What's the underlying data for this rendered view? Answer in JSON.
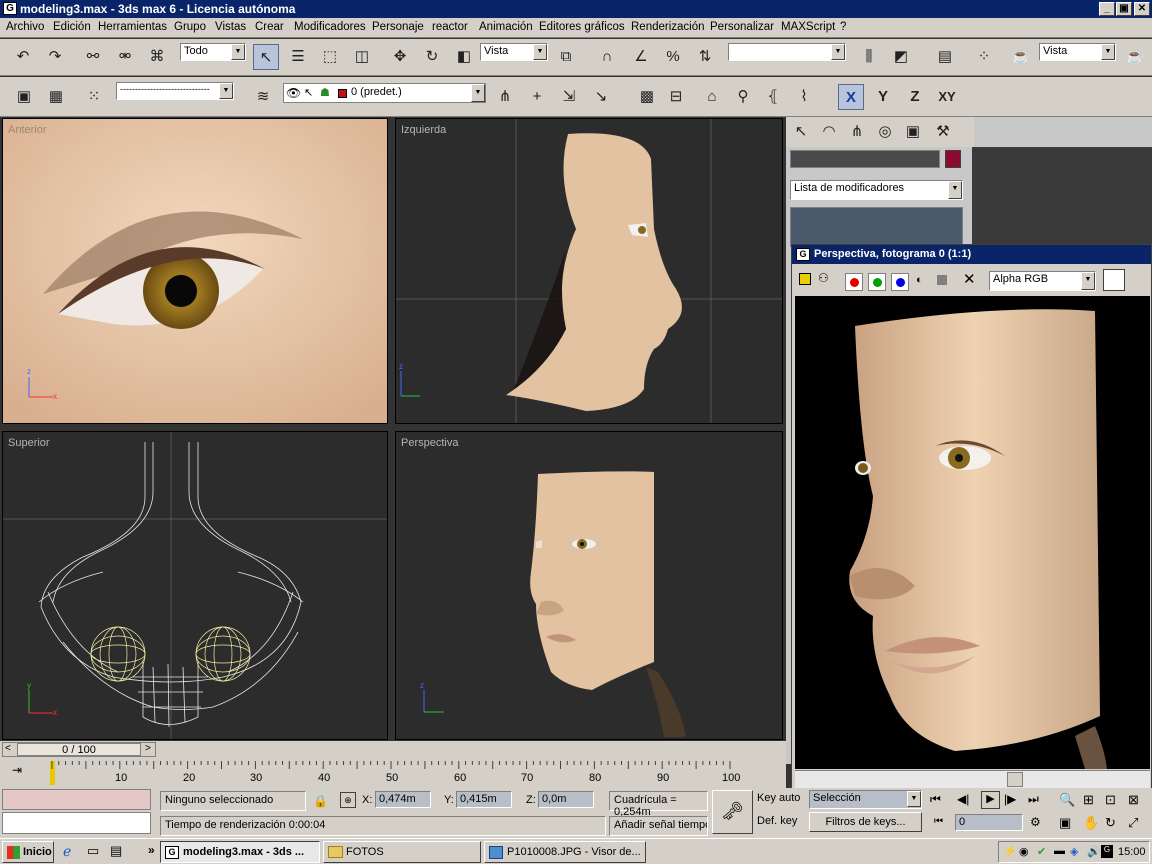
{
  "window": {
    "title": "modeling3.max - 3ds max 6 - Licencia autónoma",
    "min": "_",
    "max": "▣",
    "close": "✕"
  },
  "menu": [
    "Archivo",
    "Edición",
    "Herramientas",
    "Grupo",
    "Vistas",
    "Crear",
    "Modificadores",
    "Personaje",
    "reactor",
    "Animación",
    "Editores gráficos",
    "Renderización",
    "Personalizar",
    "MAXScript",
    "?"
  ],
  "toolbar1": {
    "filter": "Todo",
    "refcoord": "Vista",
    "namedsel": "",
    "render_view": "Vista"
  },
  "toolbar2": {
    "layer_line": "------------------------------",
    "layer_name": "0 (predet.)",
    "axis_x": "X",
    "axis_y": "Y",
    "axis_z": "Z",
    "axis_xy": "XY"
  },
  "viewports": {
    "top_left": "Anterior",
    "top_right": "Izquierda",
    "bottom_left": "Superior",
    "bottom_right": "Perspectiva"
  },
  "command_panel": {
    "name": "",
    "modifier_list": "Lista de modificadores",
    "color": "#8b0a30"
  },
  "render_window": {
    "title": "Perspectiva, fotograma 0 (1:1)",
    "channel": "Alpha RGB"
  },
  "timeline": {
    "frame": "0 / 100",
    "ticks": [
      "10",
      "20",
      "30",
      "40",
      "50",
      "60",
      "70",
      "80",
      "90",
      "100"
    ],
    "prev": "<",
    "next": ">"
  },
  "status": {
    "selection": "Ninguno seleccionado",
    "render_time": "Tiempo de renderización  0:00:04",
    "x_label": "X:",
    "x": "0,474m",
    "y_label": "Y:",
    "y": "0,415m",
    "z_label": "Z:",
    "z": "0,0m",
    "grid": "Cuadrícula = 0,254m",
    "add_tag": "Añadir señal tiempo",
    "key_auto": "Key auto",
    "def_key": "Def. key",
    "sel_mode": "Selección",
    "key_filters": "Filtros de keys...",
    "frame_field": "0"
  },
  "taskbar": {
    "start": "Inicio",
    "tasks": [
      "modeling3.max - 3ds ...",
      "FOTOS",
      "P1010008.JPG - Visor de..."
    ],
    "clock": "15:00"
  }
}
